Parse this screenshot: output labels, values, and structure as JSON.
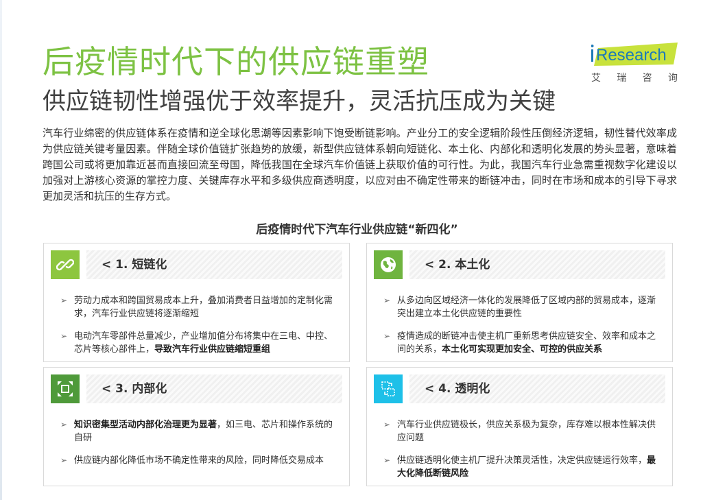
{
  "header": {
    "title": "后疫情时代下的供应链重塑",
    "subtitle": "供应链韧性增强优于效率提升，灵活抗压成为关键"
  },
  "logo": {
    "word": "iResearch",
    "cn": [
      "艾",
      "瑞",
      "咨",
      "询"
    ]
  },
  "intro": "汽车行业绵密的供应链体系在疫情和逆全球化思潮等因素影响下饱受断链影响。产业分工的安全逻辑阶段性压倒经济逻辑，韧性替代效率成为供应链关键考量因素。伴随全球价值链扩张趋势的放缓，新型供应链体系朝向短链化、本土化、内部化和透明化发展的势头显著，意味着跨国公司或将更加靠近甚而直接回流至母国，降低我国在全球汽车价值链上获取价值的可行性。为此，我国汽车行业急需重视数字化建设以加强对上游核心资源的掌控力度、关键库存水平和多级供应商透明度，以应对由不确定性带来的断链冲击，同时在市场和成本的引导下寻求更加灵活和抗压的生存方式。",
  "section_heading": "后疫情时代下汽车行业供应链“新四化”",
  "colors": {
    "title_green": "#7dc243",
    "icon_green_light": "#8dc63f",
    "icon_green": "#6fb43f",
    "icon_green_dark": "#4f9a3a",
    "icon_cyan": "#1ec0e8"
  },
  "cards": [
    {
      "title": "< 1. 短链化",
      "icon": "link-icon",
      "bullets": [
        {
          "text": "劳动力成本和跨国贸易成本上升，叠加消费者日益增加的定制化需求，汽车行业供应链将逐渐缩短",
          "bold": ""
        },
        {
          "text": "电动汽车零部件总量减少，产业增加值分布将集中在三电、中控、芯片等核心部件上，",
          "bold": "导致汽车行业供应链缩短重组"
        }
      ]
    },
    {
      "title": "< 2. 本土化",
      "icon": "globe-icon",
      "bullets": [
        {
          "text": "从多边向区域经济一体化的发展降低了区域内部的贸易成本，逐渐突出建立本土化供应链的重要性",
          "bold": ""
        },
        {
          "text": "疫情造成的断链冲击使主机厂重新思考供应链安全、效率和成本之间的关系，",
          "bold": "本土化可实现更加安全、可控的供应关系"
        }
      ]
    },
    {
      "title": "< 3. 内部化",
      "icon": "collapse-icon",
      "bullets": [
        {
          "bold": "知识密集型活动内部化治理更为显著",
          "text": "，如三电、芯片和操作系统的自研",
          "bold_first": true
        },
        {
          "text": "供应链内部化降低市场不确定性带来的风险，同时降低交易成本",
          "bold": ""
        }
      ]
    },
    {
      "title": "< 4. 透明化",
      "icon": "transparency-icon",
      "bullets": [
        {
          "text": "汽车行业供应链极长，供应关系极为复杂，库存难以根本性解决供应问题",
          "bold": ""
        },
        {
          "text": "供应链透明化使主机厂提升决策灵活性，决定供应链运行效率，",
          "bold": "最大化降低断链风险"
        }
      ]
    }
  ]
}
